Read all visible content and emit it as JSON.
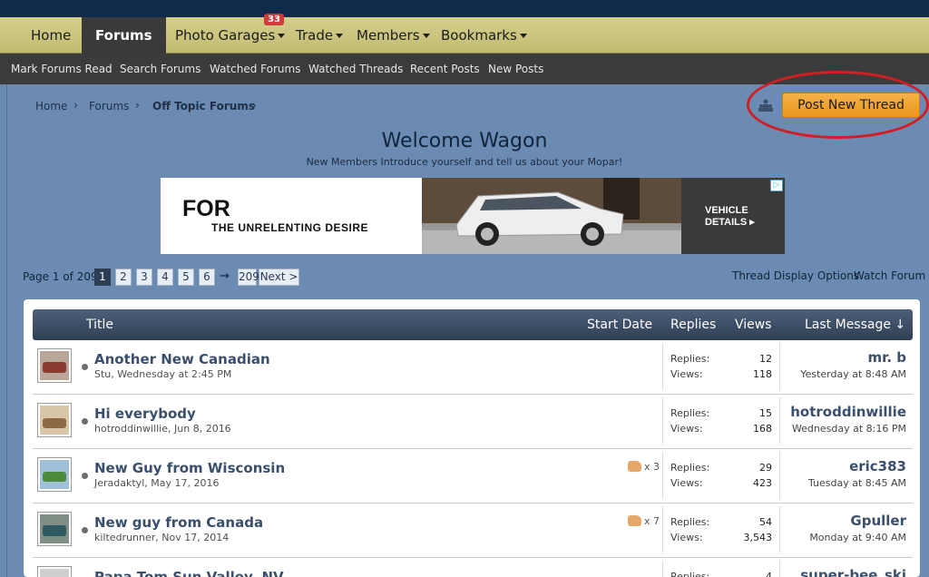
{
  "nav": {
    "tabs": [
      {
        "label": "Home"
      },
      {
        "label": "Forums"
      },
      {
        "label": "Photo Garages",
        "badge": "33"
      },
      {
        "label": "Trade"
      },
      {
        "label": "Members"
      },
      {
        "label": "Bookmarks"
      }
    ]
  },
  "subnav": {
    "items": [
      {
        "label": "Mark Forums Read"
      },
      {
        "label": "Search Forums"
      },
      {
        "label": "Watched Forums"
      },
      {
        "label": "Watched Threads"
      },
      {
        "label": "Recent Posts"
      },
      {
        "label": "New Posts"
      }
    ]
  },
  "breadcrumb": [
    {
      "label": "Home"
    },
    {
      "label": "Forums"
    },
    {
      "label": "Off Topic Forums"
    }
  ],
  "breadcrumb_sep": "›",
  "post_button": {
    "label": "Post New Thread"
  },
  "forum": {
    "title": "Welcome Wagon",
    "description": "New Members Introduce yourself and tell us about your Mopar!"
  },
  "ad": {
    "headline": "FOR",
    "tagline": "THE UNRELENTING DESIRE",
    "cta": "VEHICLE DETAILS ▸"
  },
  "pagination": {
    "label": "Page 1 of 209",
    "pages": [
      "1",
      "2",
      "3",
      "4",
      "5",
      "6"
    ],
    "ellipsis": "→",
    "last": "209",
    "next": "Next >"
  },
  "toolbar": {
    "display_options": "Thread Display Options",
    "watch": "Watch Forum"
  },
  "table": {
    "headers": {
      "title": "Title",
      "start_date": "Start Date",
      "replies": "Replies",
      "views": "Views",
      "last_message": "Last Message ↓"
    },
    "replies_label": "Replies:",
    "views_label": "Views:",
    "threads": [
      {
        "title": "Another New Canadian",
        "author": "Stu",
        "date": "Wednesday at 2:45 PM",
        "likes": "",
        "replies": "12",
        "views": "118",
        "last_user": "mr. b",
        "last_time": "Yesterday at 8:48 AM",
        "avatar_color": "#8a3a2e"
      },
      {
        "title": "Hi everybody",
        "author": "hotroddinwillie",
        "date": "Jun 8, 2016",
        "likes": "",
        "replies": "15",
        "views": "168",
        "last_user": "hotroddinwillie",
        "last_time": "Wednesday at 8:16 PM",
        "avatar_color": "#8d6a44"
      },
      {
        "title": "New Guy from Wisconsin",
        "author": "Jeradaktyl",
        "date": "May 17, 2016",
        "likes": "x 3",
        "replies": "29",
        "views": "423",
        "last_user": "eric383",
        "last_time": "Tuesday at 8:45 AM",
        "avatar_color": "#4c8a3a"
      },
      {
        "title": "New guy from Canada",
        "author": "kiltedrunner",
        "date": "Nov 17, 2014",
        "likes": "x 7",
        "replies": "54",
        "views": "3,543",
        "last_user": "Gpuller",
        "last_time": "Monday at 9:40 AM",
        "avatar_color": "#2f5a62"
      },
      {
        "title": "Papa Tom Sun Valley, NV",
        "author": "",
        "date": "",
        "likes": "",
        "replies": "4",
        "views": "",
        "last_user": "super-bee_ski",
        "last_time": "",
        "avatar_color": "#cfcfcf"
      }
    ]
  }
}
